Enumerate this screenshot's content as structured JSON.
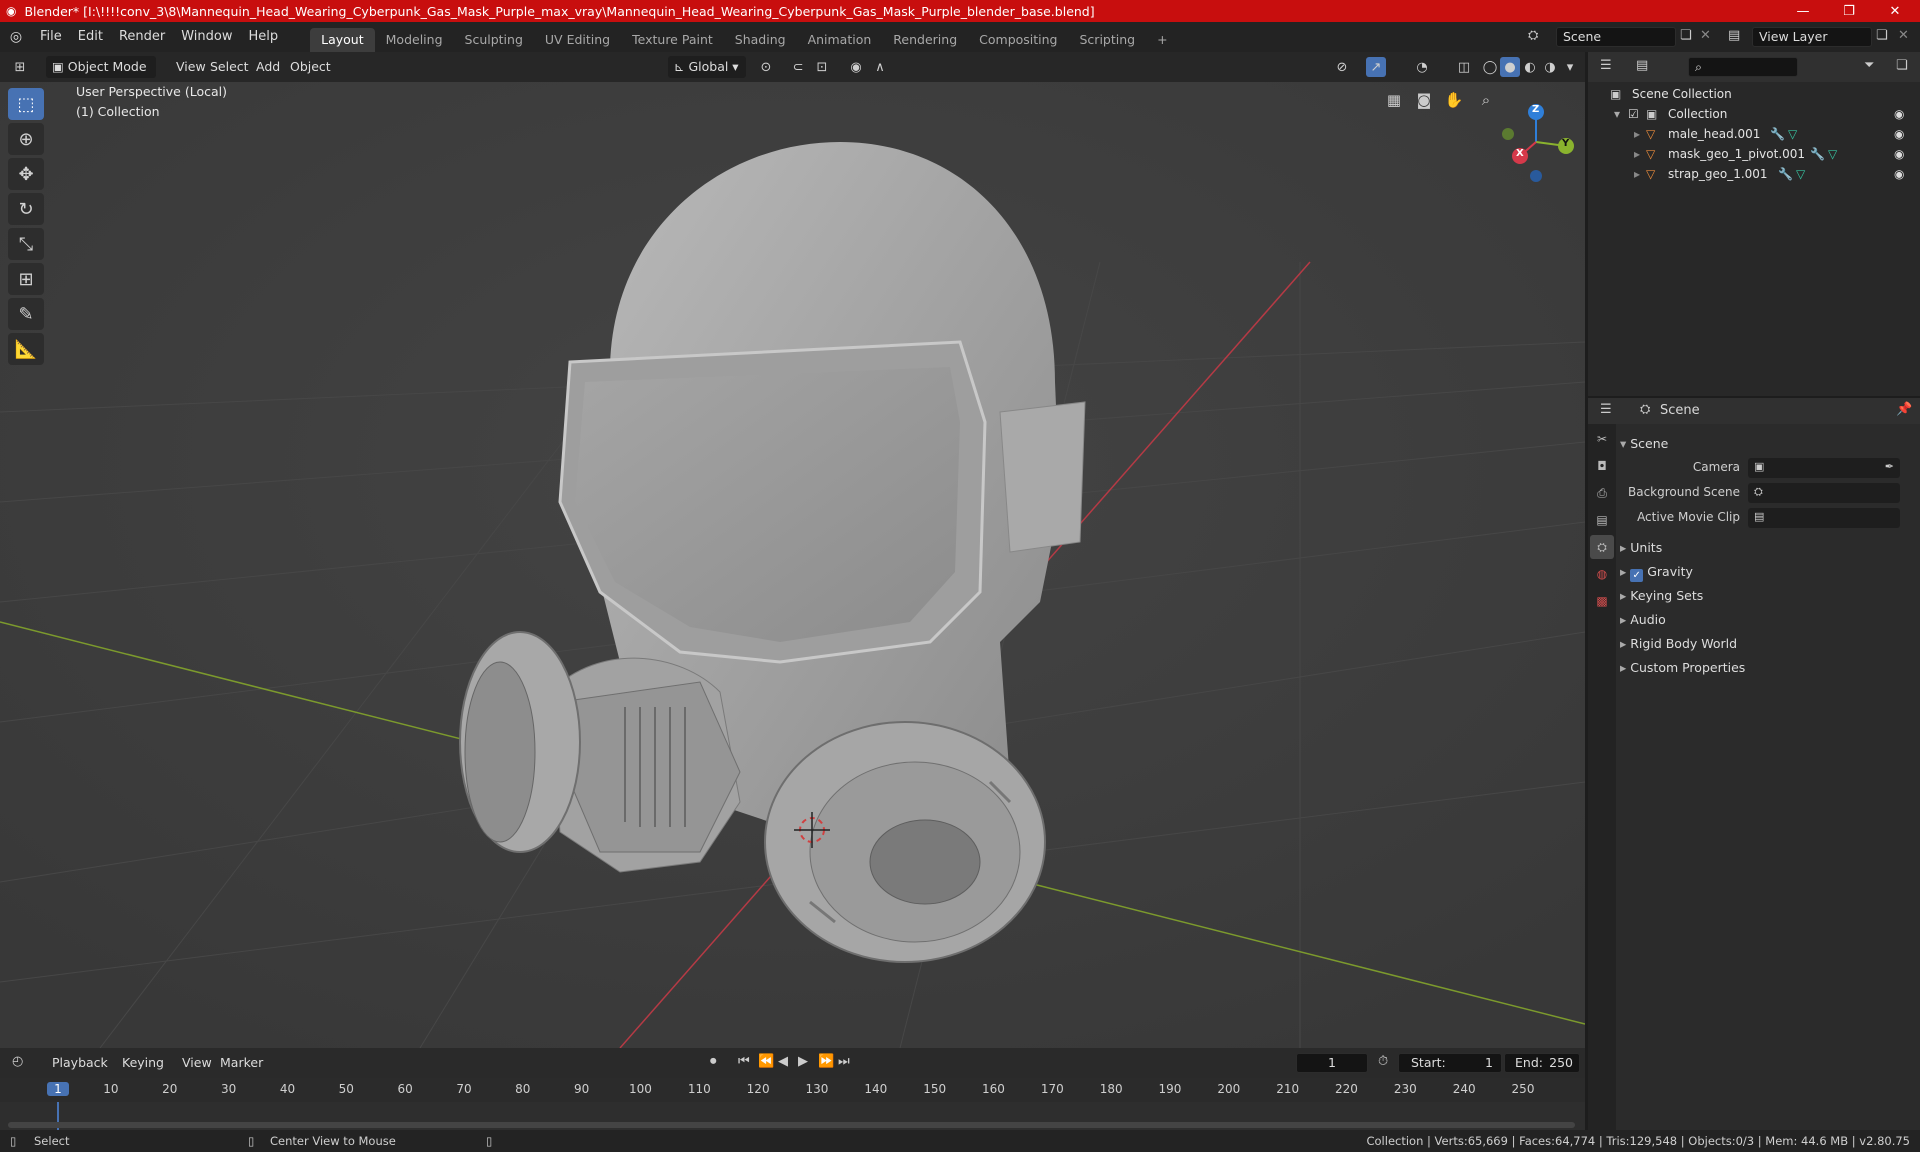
{
  "titlebar": {
    "title": "Blender* [I:\\!!!!conv_3\\8\\Mannequin_Head_Wearing_Cyberpunk_Gas_Mask_Purple_max_vray\\Mannequin_Head_Wearing_Cyberpunk_Gas_Mask_Purple_blender_base.blend]",
    "minimize": "—",
    "maximize": "❐",
    "close": "✕"
  },
  "menu": [
    "File",
    "Edit",
    "Render",
    "Window",
    "Help"
  ],
  "workspaces": [
    "Layout",
    "Modeling",
    "Sculpting",
    "UV Editing",
    "Texture Paint",
    "Shading",
    "Animation",
    "Rendering",
    "Compositing",
    "Scripting"
  ],
  "active_workspace": "Layout",
  "add_workspace": "+",
  "scene": {
    "label": "Scene",
    "view_layer": "View Layer"
  },
  "viewport_header": {
    "mode": "Object Mode",
    "view": "View",
    "select": "Select",
    "add": "Add",
    "object": "Object",
    "orientation": "Global"
  },
  "viewport": {
    "perspective": "User Perspective (Local)",
    "collection": "(1) Collection",
    "gizmo": {
      "x": "X",
      "y": "Y",
      "z": "Z"
    }
  },
  "outliner": {
    "search_placeholder": "",
    "root": "Scene Collection",
    "collection": "Collection",
    "items": [
      {
        "name": "male_head.001"
      },
      {
        "name": "mask_geo_1_pivot.001"
      },
      {
        "name": "strap_geo_1.001"
      }
    ]
  },
  "properties": {
    "context": "Scene",
    "panel": "Scene",
    "fields": [
      {
        "label": "Camera"
      },
      {
        "label": "Background Scene"
      },
      {
        "label": "Active Movie Clip"
      }
    ],
    "sections": [
      "Units",
      "Gravity",
      "Keying Sets",
      "Audio",
      "Rigid Body World",
      "Custom Properties"
    ],
    "gravity_checked": true
  },
  "timeline": {
    "menus": [
      "Playback",
      "Keying",
      "View",
      "Marker"
    ],
    "current_frame": "1",
    "start_label": "Start:",
    "start": "1",
    "end_label": "End:",
    "end": "250",
    "ticks": [
      "1",
      "10",
      "20",
      "30",
      "40",
      "50",
      "60",
      "70",
      "80",
      "90",
      "100",
      "110",
      "120",
      "130",
      "140",
      "150",
      "160",
      "170",
      "180",
      "190",
      "200",
      "210",
      "220",
      "230",
      "240",
      "250"
    ]
  },
  "statusbar": {
    "select": "Select",
    "center": "Center View to Mouse",
    "stats": "Collection | Verts:65,669 | Faces:64,774 | Tris:129,548 | Objects:0/3 | Mem: 44.6 MB | v2.80.75"
  },
  "colors": {
    "accent": "#4772b3",
    "titlebar": "#c80e0e",
    "x_axis": "#d5394a",
    "y_axis": "#8ab32e",
    "z_axis": "#2f7fd9"
  }
}
